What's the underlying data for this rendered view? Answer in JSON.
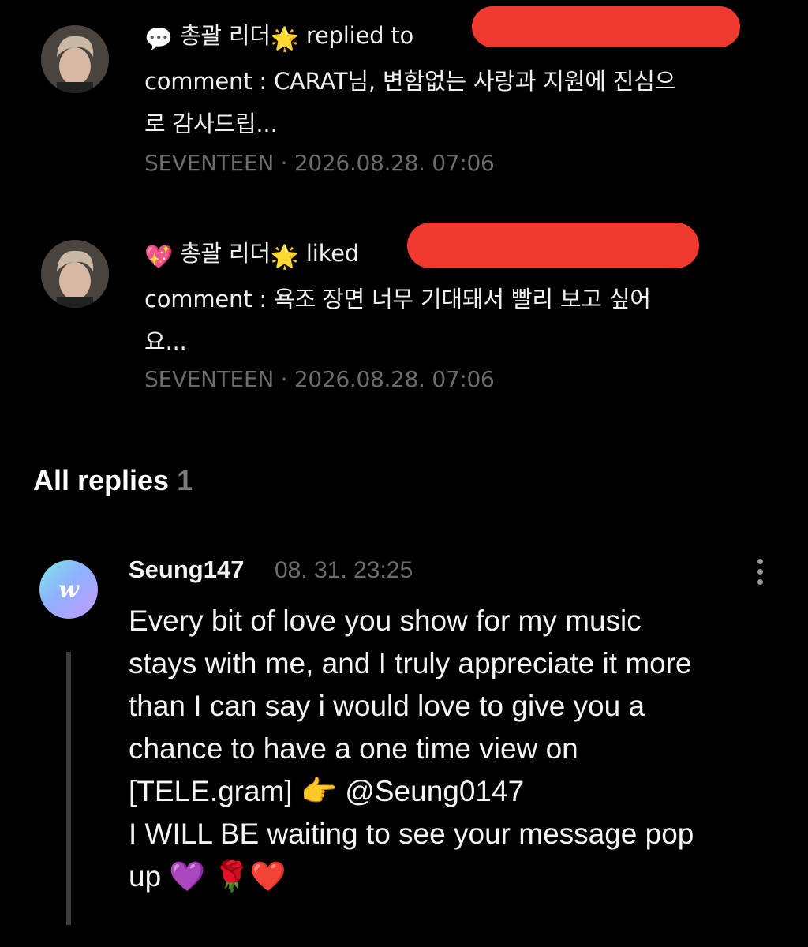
{
  "notifications": [
    {
      "icon": "💬",
      "user": "총괄 리더",
      "user_emoji": "🌟",
      "action": "replied to",
      "comment_label": "comment :",
      "comment_text": "CARAT님, 변함없는 사랑과 지원에 진심으",
      "comment_text_cont": "로 감사드립...",
      "source": "SEVENTEEN",
      "separator": "·",
      "timestamp": "2026.08.28. 07:06"
    },
    {
      "icon": "💖",
      "user": "총괄 리더",
      "user_emoji": "🌟",
      "action": "liked",
      "comment_label": "comment :",
      "comment_text": "욕조 장면 너무 기대돼서 빨리 보고 싶어",
      "comment_text_cont": "요...",
      "source": "SEVENTEEN",
      "separator": "·",
      "timestamp": "2026.08.28. 07:06"
    }
  ],
  "replies_section": {
    "title": "All replies",
    "count": "1"
  },
  "reply": {
    "avatar_letter": "w",
    "username": "Seung147",
    "time": "08. 31. 23:25",
    "lines": [
      "Every bit of love you show for my music",
      "stays with me, and I truly appreciate it more",
      "than I can say i would love to give you a",
      "chance to have a one time view on",
      "[TELE.gram] 👉 @Seung0147",
      "I WILL BE waiting to see your message pop",
      "up 💜 🌹❤️"
    ]
  },
  "colors": {
    "background": "#000000",
    "redaction": "#f0392f",
    "muted_text": "#6c6c6c"
  }
}
